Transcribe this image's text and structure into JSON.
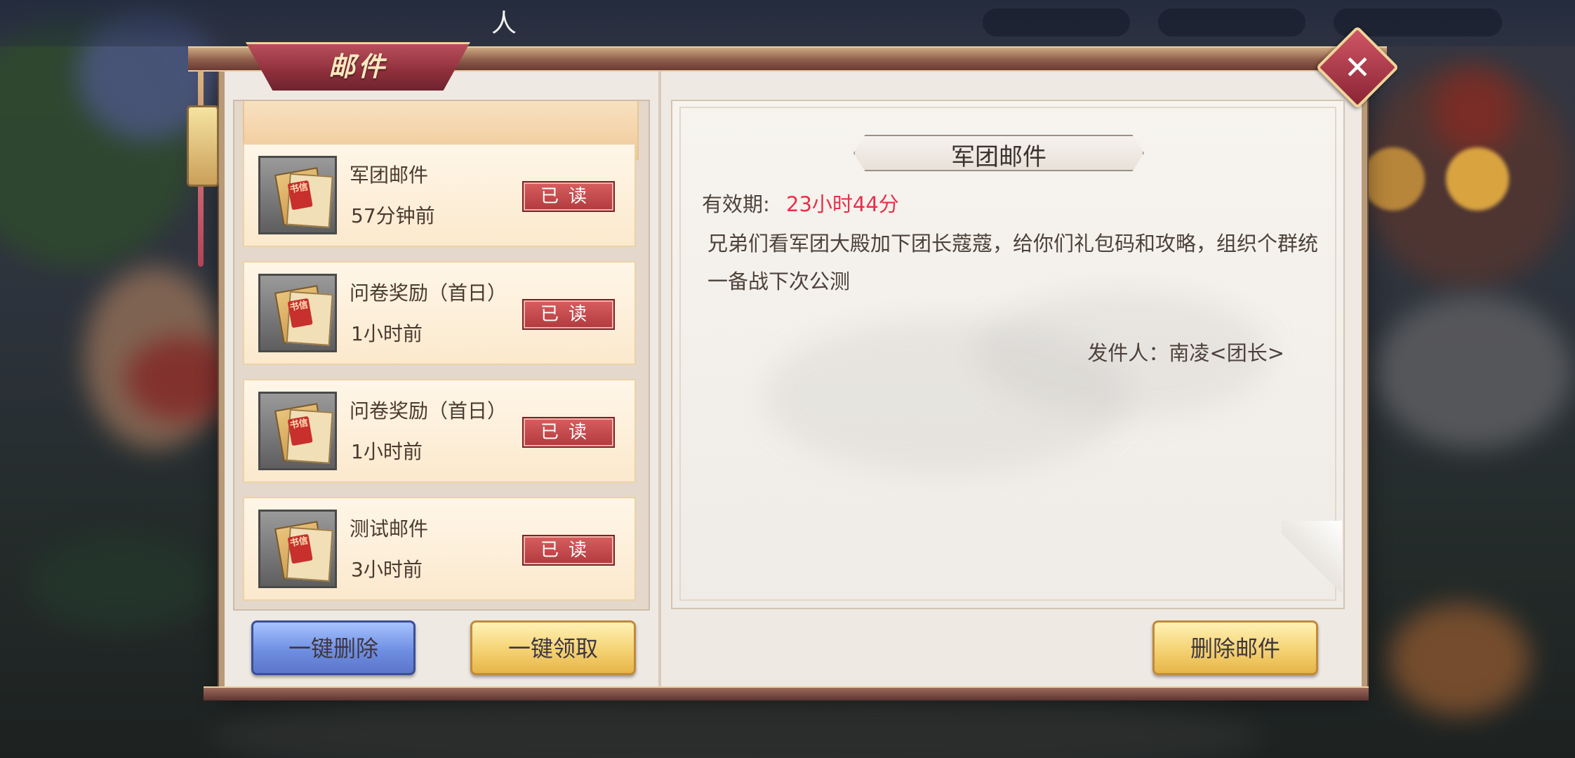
{
  "header": {
    "title": "人"
  },
  "dialog": {
    "title": "邮件",
    "close_icon": "close-x-icon"
  },
  "mail_list": [
    {
      "title": "军团邮件",
      "time": "57分钟前",
      "status": "已读",
      "icon": "letter-icon",
      "seal": "书信"
    },
    {
      "title": "问卷奖励（首日）",
      "time": "1小时前",
      "status": "已读",
      "icon": "letter-icon",
      "seal": "书信"
    },
    {
      "title": "问卷奖励（首日）",
      "time": "1小时前",
      "status": "已读",
      "icon": "letter-icon",
      "seal": "书信"
    },
    {
      "title": "测试邮件",
      "time": "3小时前",
      "status": "已读",
      "icon": "letter-icon",
      "seal": "书信"
    }
  ],
  "list_actions": {
    "delete_all": "一键删除",
    "claim_all": "一键领取"
  },
  "detail": {
    "title": "军团邮件",
    "validity_label": "有效期:",
    "validity_value": "23小时44分",
    "body": "兄弟们看军团大殿加下团长蔻蔻，给你们礼包码和攻略，组织个群统一备战下次公测",
    "sender": "发件人：南凌<团长>",
    "delete_button": "删除邮件"
  },
  "colors": {
    "accent_red": "#e5304a",
    "read_badge": "#b13a3e",
    "button_blue": "#6f8fe2",
    "button_gold": "#f4d273",
    "title_tab": "#8e2f3b"
  }
}
